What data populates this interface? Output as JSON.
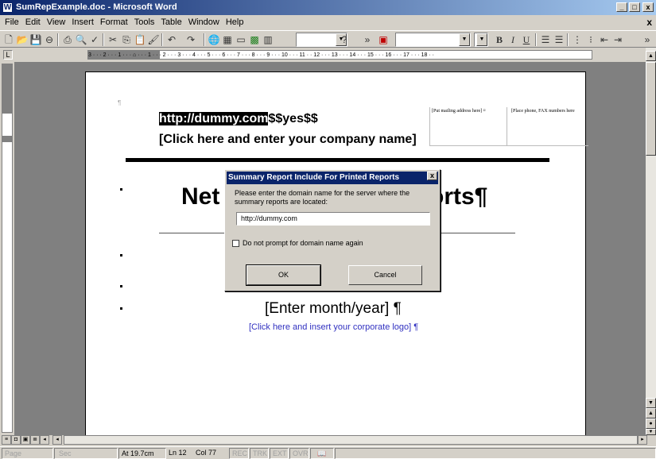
{
  "window": {
    "title": "SumRepExample.doc - Microsoft Word",
    "app_icon": "W",
    "minimize": "_",
    "maximize": "□",
    "close": "x"
  },
  "menu": {
    "items": [
      "File",
      "Edit",
      "View",
      "Insert",
      "Format",
      "Tools",
      "Table",
      "Window",
      "Help"
    ],
    "doc_close": "x"
  },
  "toolbar": {
    "icons": [
      "new-icon",
      "open-icon",
      "save-icon",
      "permission-icon",
      "print-icon",
      "print-preview-icon",
      "spelling-icon",
      "cut-icon",
      "copy-icon",
      "paste-icon",
      "format-painter-icon",
      "undo-icon",
      "redo-icon",
      "hyperlink-icon",
      "tables-icon",
      "insert-table-icon",
      "excel-icon",
      "columns-icon",
      "help-icon",
      "overflow-icon",
      "research-icon",
      "bold-icon",
      "italic-icon",
      "underline-icon",
      "align-left-icon",
      "center-icon",
      "numbering-icon",
      "bullets-icon",
      "decrease-indent-icon",
      "increase-indent-icon"
    ],
    "bold": "B",
    "italic": "I",
    "underline": "U",
    "overflow": "»"
  },
  "ruler": {
    "marks": "3 · · · 2 · · · 1 · · · ⌂ · · · 1 · · · 2 · · · 3 · · · 4 · · · 5 · · · 6 · · · 7 · · · 8 · · · 9 · · · 10 · · · 11 · · 12 · · · 13 · · · 14 · · · 15 · · · 16 · · · 17 · · · 18 · · "
  },
  "document": {
    "pilcrow": "¶",
    "url_selected": "http://dummy.com",
    "url_rest": "$$yes$$",
    "company": "[Click here and enter your company name]",
    "address_cell": "[Put mailing address here] ¤",
    "phone_cell": "[Place phone, FAX numbers here",
    "title_left": "Net",
    "title_right": "orts¶",
    "month": "[Enter month/year] ¶",
    "logo": "[Click here and insert your corporate logo] ¶"
  },
  "dialog": {
    "title": "Summary Report Include For Printed Reports",
    "close": "x",
    "prompt": "Please enter the domain name for the server where the summary reports are located:",
    "input_value": "http://dummy.com",
    "checkbox_label": "Do not prompt for domain name again",
    "checkbox_checked": false,
    "ok": "OK",
    "cancel": "Cancel"
  },
  "status": {
    "page": "Page",
    "sec": "Sec",
    "position": "At 19.7cm",
    "line": "Ln 12",
    "col": "Col 77",
    "rec": "REC",
    "trk": "TRK",
    "ext": "EXT",
    "ovr": "OVR"
  }
}
